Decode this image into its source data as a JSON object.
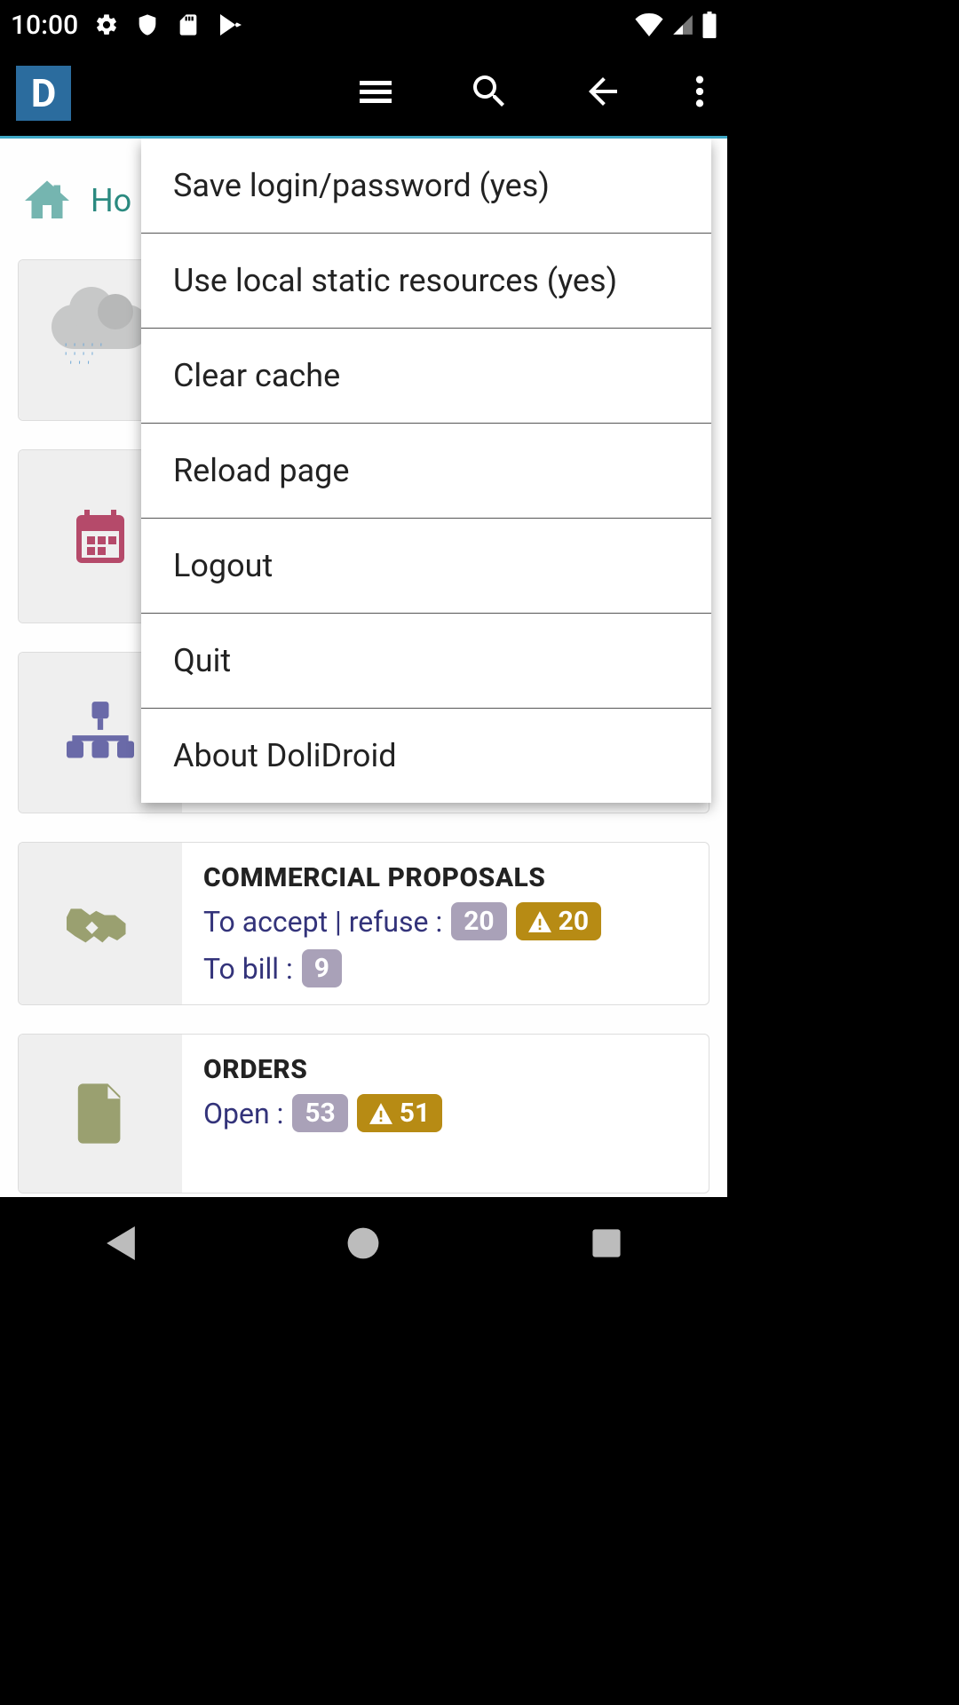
{
  "status": {
    "time": "10:00"
  },
  "home": {
    "label": "Ho"
  },
  "dropdown": {
    "items": [
      "Save login/password (yes)",
      "Use local static resources (yes)",
      "Clear cache",
      "Reload page",
      "Logout",
      "Quit",
      "About DoliDroid"
    ]
  },
  "cards": {
    "proposals": {
      "title": "COMMERCIAL PROPOSALS",
      "line1_label": "To accept | refuse :",
      "line1_badge": "20",
      "line1_warn": "20",
      "line2_label": "To bill :",
      "line2_badge": "9"
    },
    "orders": {
      "title": "ORDERS",
      "line1_label": "Open :",
      "line1_badge": "53",
      "line1_warn": "51"
    }
  }
}
